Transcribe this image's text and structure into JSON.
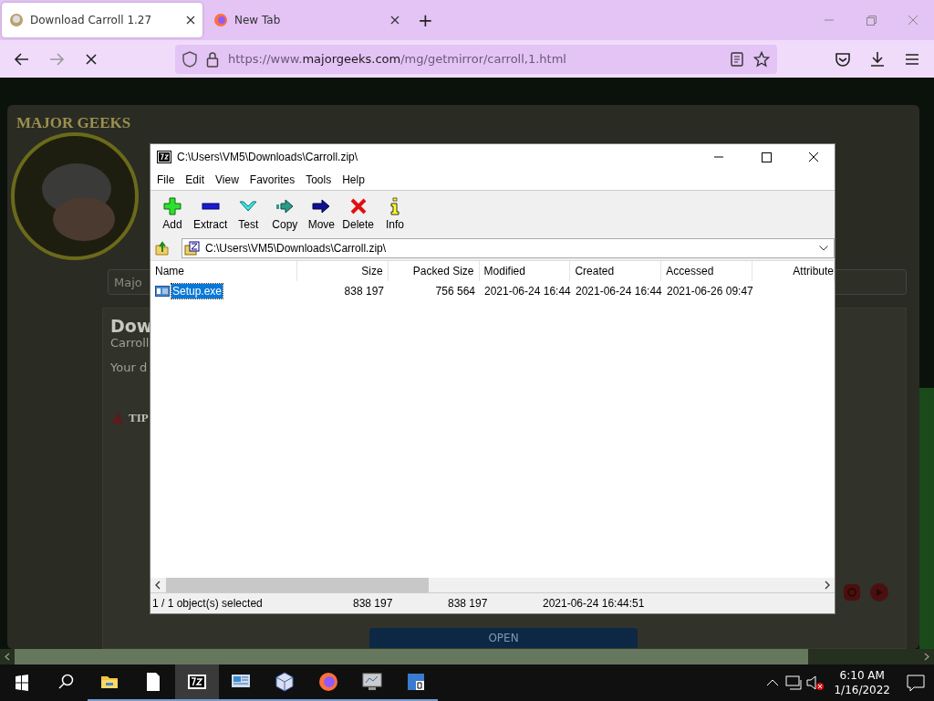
{
  "browser": {
    "tabs": [
      {
        "title": "Download Carroll 1.27",
        "selected": true
      },
      {
        "title": "New Tab",
        "selected": false
      }
    ],
    "new_tab": "+",
    "address": {
      "prefix": "https://www.",
      "domain": "majorgeeks.com",
      "path": "/mg/getmirror/carroll,1.html"
    }
  },
  "page_behind": {
    "logo_text": "MAJOR GEEKS",
    "search_value": "Majo",
    "heading": "Dow",
    "subtitle": "Carroll",
    "text": "Your d",
    "tip": "TIP",
    "button": "OPEN"
  },
  "archive_window": {
    "title": "C:\\Users\\VM5\\Downloads\\Carroll.zip\\",
    "menu": [
      "File",
      "Edit",
      "View",
      "Favorites",
      "Tools",
      "Help"
    ],
    "toolbar": [
      {
        "label": "Add",
        "kind": "add"
      },
      {
        "label": "Extract",
        "kind": "extract"
      },
      {
        "label": "Test",
        "kind": "test"
      },
      {
        "label": "Copy",
        "kind": "copy"
      },
      {
        "label": "Move",
        "kind": "move"
      },
      {
        "label": "Delete",
        "kind": "delete"
      },
      {
        "label": "Info",
        "kind": "info"
      }
    ],
    "path": "C:\\Users\\VM5\\Downloads\\Carroll.zip\\",
    "columns": [
      "Name",
      "Size",
      "Packed Size",
      "Modified",
      "Created",
      "Accessed",
      "Attribute"
    ],
    "rows": [
      {
        "cells": [
          "Setup.exe",
          "838 197",
          "756 564",
          "2021-06-24 16:44",
          "2021-06-24 16:44",
          "2021-06-26 09:47"
        ],
        "selected": true
      }
    ],
    "status_bar": [
      "1 / 1 object(s) selected",
      "838 197",
      "838 197",
      "2021-06-24 16:44:51"
    ]
  },
  "taskbar": {
    "apps": [
      {
        "kind": "folder",
        "selected": false
      },
      {
        "kind": "file",
        "selected": false
      },
      {
        "kind": "archiver",
        "selected": true
      },
      {
        "kind": "monitor",
        "selected": false
      },
      {
        "kind": "cube",
        "selected": false
      },
      {
        "kind": "firefox",
        "selected": false
      },
      {
        "kind": "screen",
        "selected": false
      },
      {
        "kind": "blocks",
        "selected": false
      }
    ],
    "time": "6:10 AM",
    "date": "1/16/2022"
  }
}
